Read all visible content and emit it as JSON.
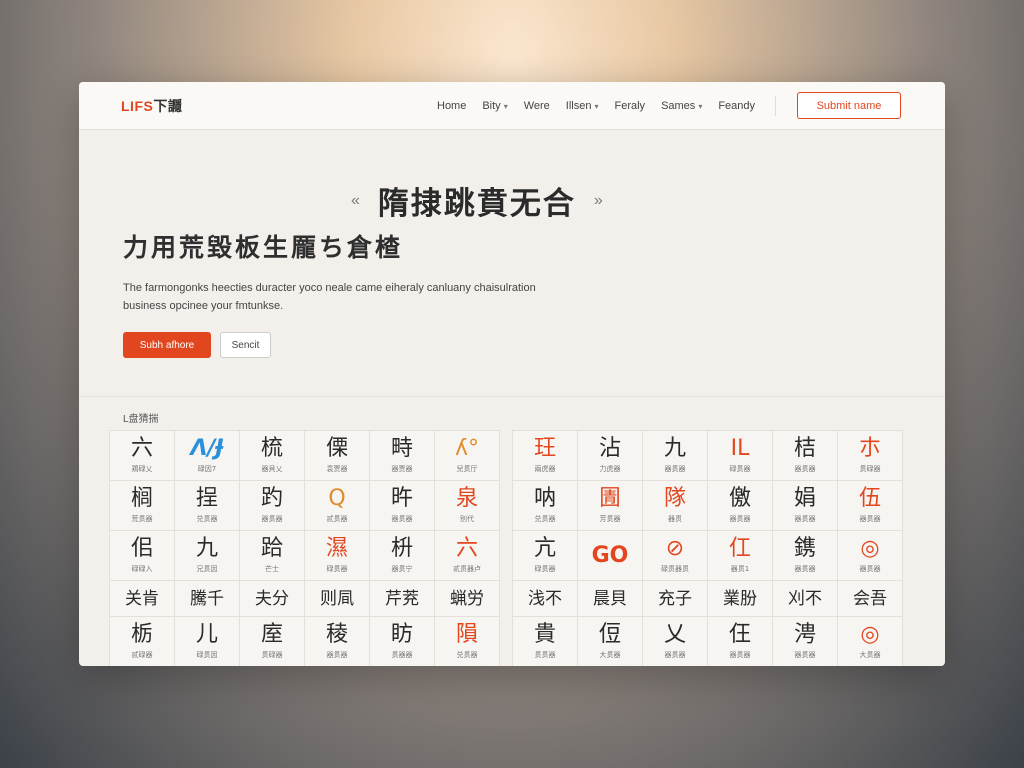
{
  "header": {
    "logo_accent": "LIFS",
    "logo_rest": "下讔",
    "nav": [
      {
        "label": "Home",
        "dropdown": false
      },
      {
        "label": "Bity",
        "dropdown": true
      },
      {
        "label": "Were",
        "dropdown": false
      },
      {
        "label": "Illsen",
        "dropdown": true
      },
      {
        "label": "Feraly",
        "dropdown": false
      },
      {
        "label": "Sames",
        "dropdown": true
      },
      {
        "label": "Feandy",
        "dropdown": false
      }
    ],
    "cta_label": "Submit name"
  },
  "hero": {
    "quote_left": "«",
    "quote_right": "»",
    "title": "隋捸跳賁无合",
    "subtitle": "力用荒毀板生龎ち倉楂",
    "description": "The farmongonks heecties duracter yoco neale came eiheraly canluany chaisulration business opcinee your fmtunkse.",
    "primary_button": "Subh afhore",
    "secondary_button": "Sencit"
  },
  "section_label": "L盘猜揣",
  "grids": {
    "left": [
      {
        "glyph": "六",
        "caption": "鶏碌乂",
        "style": ""
      },
      {
        "glyph": "Ʌ/Ɉ",
        "caption": "碌因7",
        "style": "blue"
      },
      {
        "glyph": "梳",
        "caption": "器貝乂",
        "style": ""
      },
      {
        "glyph": "傈",
        "caption": "袁贾器",
        "style": ""
      },
      {
        "glyph": "畤",
        "caption": "器贾器",
        "style": ""
      },
      {
        "glyph": "ʎ°",
        "caption": "兒贯厅",
        "style": "orange"
      },
      {
        "glyph": "榈",
        "caption": "荒贯器",
        "style": ""
      },
      {
        "glyph": "挰",
        "caption": "兑贯器",
        "style": ""
      },
      {
        "glyph": "趵",
        "caption": "器贯器",
        "style": ""
      },
      {
        "glyph": "Q",
        "caption": "贰贯器",
        "style": "orange"
      },
      {
        "glyph": "旿",
        "caption": "器贯器",
        "style": ""
      },
      {
        "glyph": "泉",
        "caption": "别代",
        "style": "red"
      },
      {
        "glyph": "佀",
        "caption": "碌碌入",
        "style": ""
      },
      {
        "glyph": "九",
        "caption": "兄贯因",
        "style": ""
      },
      {
        "glyph": "跲",
        "caption": "芒士",
        "style": ""
      },
      {
        "glyph": "濕",
        "caption": "碌贯器",
        "style": "red"
      },
      {
        "glyph": "枡",
        "caption": "器贯宁",
        "style": ""
      },
      {
        "glyph": "六",
        "caption": "贰贯器卢",
        "style": "red"
      },
      {
        "glyph": "关肯",
        "caption": "",
        "style": "short"
      },
      {
        "glyph": "騰千",
        "caption": "",
        "style": "short"
      },
      {
        "glyph": "夫分",
        "caption": "",
        "style": "short"
      },
      {
        "glyph": "则凬",
        "caption": "",
        "style": "short"
      },
      {
        "glyph": "芹茺",
        "caption": "",
        "style": "short"
      },
      {
        "glyph": "蝋労",
        "caption": "",
        "style": "short"
      },
      {
        "glyph": "栃",
        "caption": "贰碌器",
        "style": ""
      },
      {
        "glyph": "儿",
        "caption": "碌贯因",
        "style": ""
      },
      {
        "glyph": "庢",
        "caption": "贯碌器",
        "style": ""
      },
      {
        "glyph": "稜",
        "caption": "器贯器",
        "style": ""
      },
      {
        "glyph": "眆",
        "caption": "贯器器",
        "style": ""
      },
      {
        "glyph": "隕",
        "caption": "兑贯器",
        "style": "red"
      }
    ],
    "right": [
      {
        "glyph": "玨",
        "caption": "兩虎器",
        "style": "red"
      },
      {
        "glyph": "沾",
        "caption": "力虎器",
        "style": ""
      },
      {
        "glyph": "九",
        "caption": "器贯器",
        "style": ""
      },
      {
        "glyph": "IL",
        "caption": "碌贯器",
        "style": "red"
      },
      {
        "glyph": "桔",
        "caption": "器贯器",
        "style": ""
      },
      {
        "glyph": "朩",
        "caption": "贯碌器",
        "style": "red"
      },
      {
        "glyph": "呐",
        "caption": "兑贯器",
        "style": ""
      },
      {
        "glyph": "圊",
        "caption": "芳贯器",
        "style": "red"
      },
      {
        "glyph": "隊",
        "caption": "器贯",
        "style": "red"
      },
      {
        "glyph": "儌",
        "caption": "器贯器",
        "style": ""
      },
      {
        "glyph": "娟",
        "caption": "器贯器",
        "style": ""
      },
      {
        "glyph": "伍",
        "caption": "器贯器",
        "style": "red"
      },
      {
        "glyph": "亢",
        "caption": "碌贯器",
        "style": ""
      },
      {
        "glyph": "GO",
        "caption": "",
        "style": "red bold"
      },
      {
        "glyph": "⊘",
        "caption": "碌贯器贯",
        "style": "red"
      },
      {
        "glyph": "仜",
        "caption": "器贯1",
        "style": "red"
      },
      {
        "glyph": "鎸",
        "caption": "器贯器",
        "style": ""
      },
      {
        "glyph": "◎",
        "caption": "器贯器",
        "style": "red"
      },
      {
        "glyph": "浅不",
        "caption": "",
        "style": "short"
      },
      {
        "glyph": "晨貝",
        "caption": "",
        "style": "short"
      },
      {
        "glyph": "充子",
        "caption": "",
        "style": "short"
      },
      {
        "glyph": "業朌",
        "caption": "",
        "style": "short"
      },
      {
        "glyph": "刈不",
        "caption": "",
        "style": "short"
      },
      {
        "glyph": "会吾",
        "caption": "",
        "style": "short"
      },
      {
        "glyph": "貴",
        "caption": "贯贯器",
        "style": ""
      },
      {
        "glyph": "侸",
        "caption": "大贯器",
        "style": ""
      },
      {
        "glyph": "乂",
        "caption": "器贯器",
        "style": ""
      },
      {
        "glyph": "仼",
        "caption": "器贯器",
        "style": ""
      },
      {
        "glyph": "涄",
        "caption": "器贯器",
        "style": ""
      },
      {
        "glyph": "◎",
        "caption": "大贯器",
        "style": "red"
      }
    ]
  },
  "colors": {
    "accent": "#e2461f",
    "orange": "#e08b2e",
    "blue": "#2a90d8"
  }
}
